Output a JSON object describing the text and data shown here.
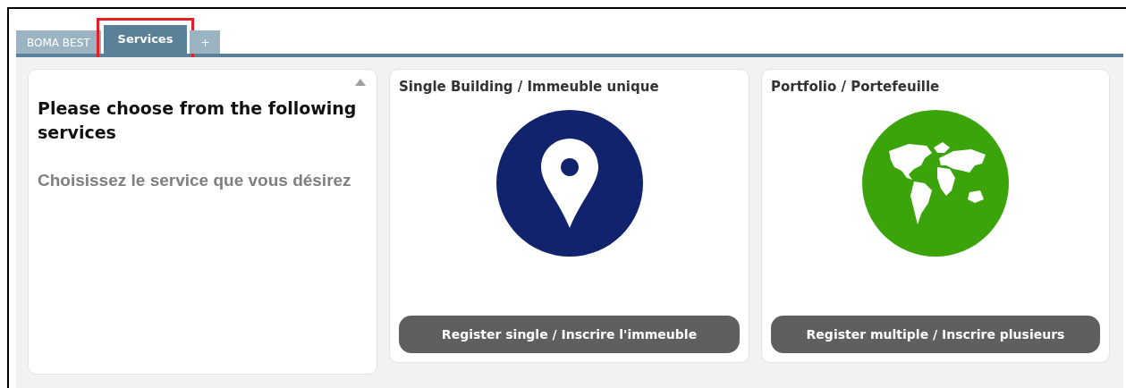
{
  "tabs": [
    {
      "label": "BOMA BEST",
      "selected": false,
      "highlighted": false
    },
    {
      "label": "Services",
      "selected": true,
      "highlighted": true
    },
    {
      "label": "+",
      "selected": false,
      "highlighted": false
    }
  ],
  "intro": {
    "heading": "Please choose from the following services",
    "subheading": "Choisissez le service que vous désirez"
  },
  "services": [
    {
      "title": "Single Building / Immeuble unique",
      "kind": "pin",
      "color": "#12236e",
      "button": "Register single / Inscrire l'immeuble"
    },
    {
      "title": "Portfolio / Portefeuille",
      "kind": "globe",
      "color": "#3ba40b",
      "button": "Register multiple / Inscrire plusieurs"
    }
  ]
}
